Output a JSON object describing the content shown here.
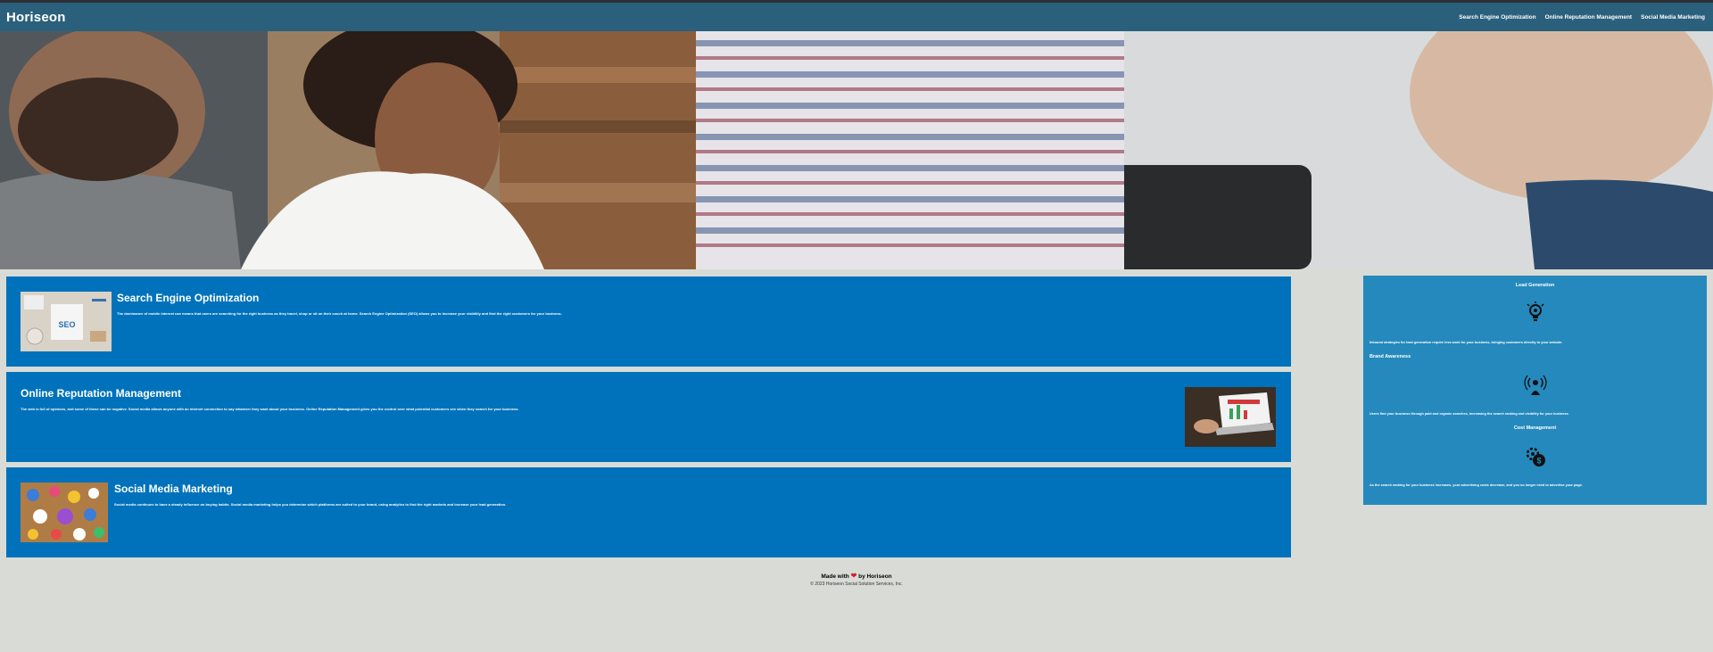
{
  "header": {
    "brand": "Horiseon",
    "nav": [
      {
        "label": "Search Engine Optimization"
      },
      {
        "label": "Online Reputation Management"
      },
      {
        "label": "Social Media Marketing"
      }
    ]
  },
  "cards": [
    {
      "title": "Search Engine Optimization",
      "text": "The dominance of mobile internet use means that users are searching for the right business as they travel, shop or sit on their couch at home. Search Engine Optimization (SEO) allows you to increase your visibility and find the right customers for your business."
    },
    {
      "title": "Online Reputation Management",
      "text": "The web is full of opinions, and some of these can be negative. Social media allows anyone with an internet connection to say whatever they want about your business. Online Reputation Management gives you the control over what potential customers see when they search for your business."
    },
    {
      "title": "Social Media Marketing",
      "text": "Social media continues to have a steady influence on buying habits. Social media marketing helps you determine which platforms are suited to your brand, using analytics to find the right markets and increase your lead generation."
    }
  ],
  "sidebar": [
    {
      "title": "Lead Generation",
      "text": "Inbound strategies for lead generation require less work for your business, bringing customers directly to your website.",
      "icon": "lightbulb-gear-icon"
    },
    {
      "title": "Brand Awareness",
      "text": "Users find your business through paid and organic searches, increasing the search ranking and visibility for your business.",
      "icon": "broadcast-person-icon"
    },
    {
      "title": "Cost Management",
      "text": "As the search ranking for your business increases, your advertising costs decrease, and you no longer need to advertise your page.",
      "icon": "gears-dollar-icon"
    }
  ],
  "footer": {
    "made_prefix": "Made with",
    "heart": "❤",
    "made_suffix": "by Horiseon",
    "copyright": "© 2023 Horiseon Social Solution Services, Inc."
  },
  "colors": {
    "header_bg": "#2a607c",
    "card_bg": "#0072bb",
    "sidebar_bg": "#2589bd",
    "page_bg": "#d9dcd6",
    "heart": "#d21f2c"
  }
}
